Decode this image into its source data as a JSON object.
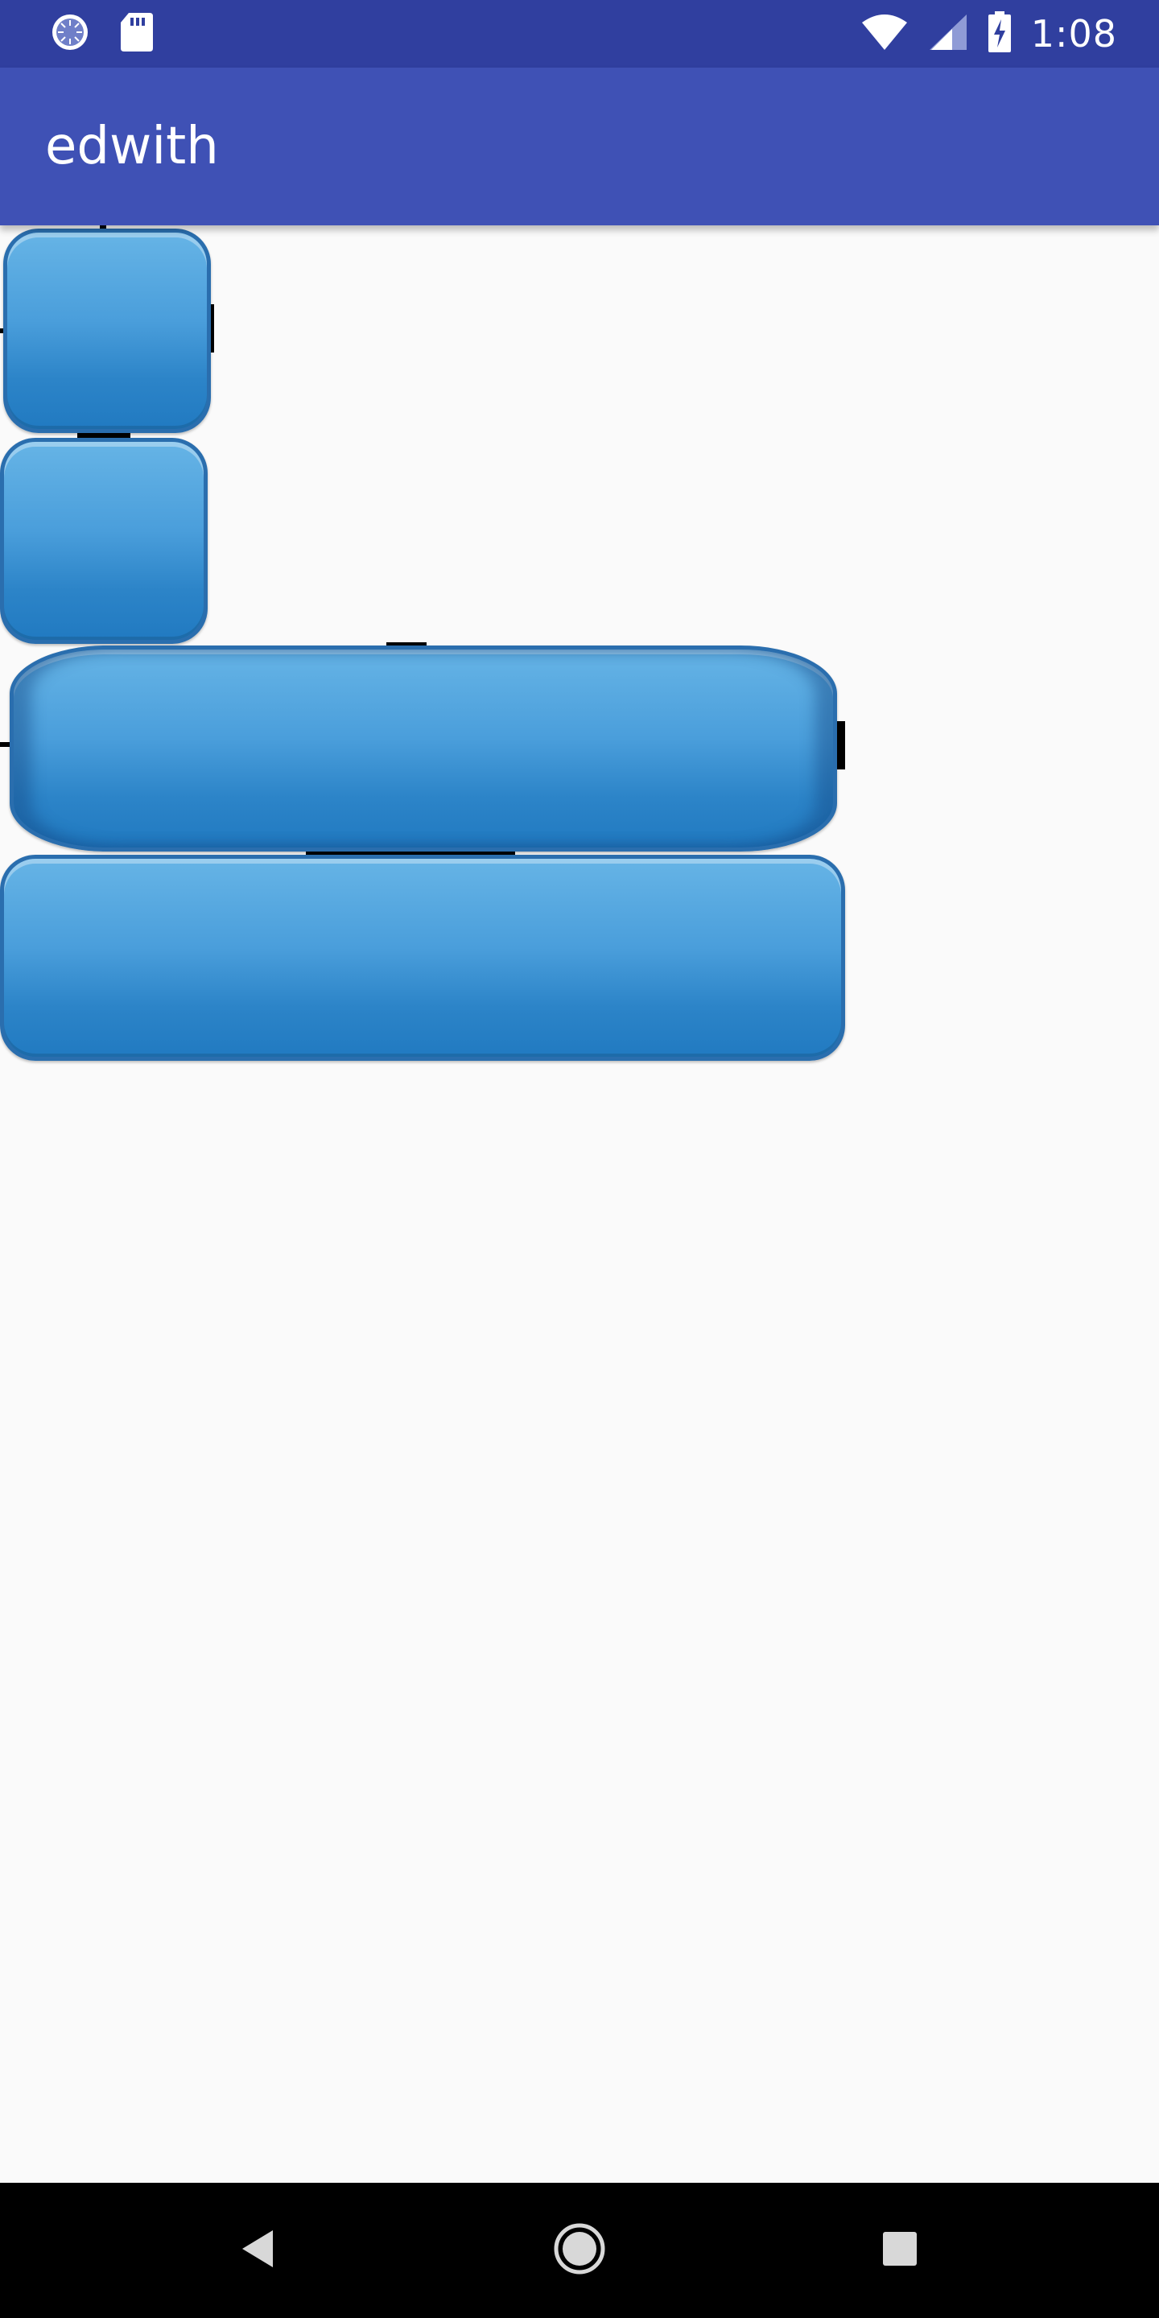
{
  "status_bar": {
    "time": "1:08",
    "icons_left": [
      "loading-icon",
      "sd-card-icon"
    ],
    "icons_right": [
      "wifi-icon",
      "signal-icon",
      "battery-charging-icon"
    ]
  },
  "app_bar": {
    "title": "edwith"
  },
  "content": {
    "buttons": [
      {
        "name": "glossy-button-small-1"
      },
      {
        "name": "glossy-button-small-2"
      },
      {
        "name": "glossy-button-wide-stretched"
      },
      {
        "name": "glossy-button-wide"
      }
    ]
  },
  "nav_bar": {
    "icons": [
      "back-icon",
      "home-icon",
      "recents-icon"
    ]
  },
  "colors": {
    "status_bar": "#303F9F",
    "app_bar": "#3F51B5",
    "background": "#FAFAFA",
    "button_blue": "#3A93D6",
    "button_border": "#2A6EAE",
    "nav_bar": "#000000"
  }
}
